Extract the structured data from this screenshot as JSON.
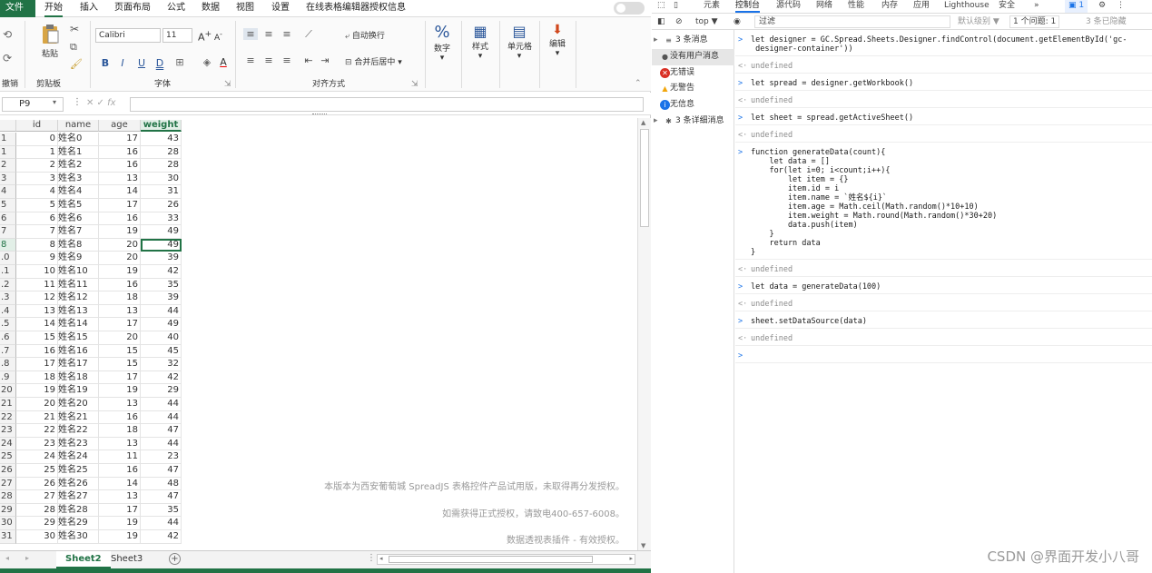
{
  "menu": {
    "tabs": [
      "文件",
      "开始",
      "插入",
      "页面布局",
      "公式",
      "数据",
      "视图",
      "设置",
      "在线表格编辑器授权信息"
    ]
  },
  "ribbon": {
    "undo_label": "撤销",
    "clipboard": {
      "paste": "粘贴",
      "group": "剪贴板"
    },
    "font": {
      "name": "Calibri",
      "size": "11",
      "bold": "B",
      "italic": "I",
      "underline": "U",
      "double_underline": "D",
      "group": "字体"
    },
    "align": {
      "wrap": "自动换行",
      "merge": "合并后居中",
      "group": "对齐方式"
    },
    "number": {
      "label": "数字"
    },
    "style": {
      "label": "样式"
    },
    "cell": {
      "label": "单元格"
    },
    "edit": {
      "label": "编辑"
    }
  },
  "formula": {
    "namebox": "P9",
    "fx": "fx"
  },
  "grid": {
    "columns": [
      "id",
      "name",
      "age",
      "weight"
    ],
    "selected_row": 9,
    "rows": [
      {
        "rh": "1",
        "id": "0",
        "name": "姓名0",
        "age": "17",
        "weight": "43"
      },
      {
        "rh": "1",
        "id": "1",
        "name": "姓名1",
        "age": "16",
        "weight": "28"
      },
      {
        "rh": "2",
        "id": "2",
        "name": "姓名2",
        "age": "16",
        "weight": "28"
      },
      {
        "rh": "3",
        "id": "3",
        "name": "姓名3",
        "age": "13",
        "weight": "30"
      },
      {
        "rh": "4",
        "id": "4",
        "name": "姓名4",
        "age": "14",
        "weight": "31"
      },
      {
        "rh": "5",
        "id": "5",
        "name": "姓名5",
        "age": "17",
        "weight": "26"
      },
      {
        "rh": "6",
        "id": "6",
        "name": "姓名6",
        "age": "16",
        "weight": "33"
      },
      {
        "rh": "7",
        "id": "7",
        "name": "姓名7",
        "age": "19",
        "weight": "49"
      },
      {
        "rh": "8",
        "id": "8",
        "name": "姓名8",
        "age": "20",
        "weight": "49"
      },
      {
        "rh": ".0",
        "id": "9",
        "name": "姓名9",
        "age": "20",
        "weight": "39"
      },
      {
        "rh": ".1",
        "id": "10",
        "name": "姓名10",
        "age": "19",
        "weight": "42"
      },
      {
        "rh": ".2",
        "id": "11",
        "name": "姓名11",
        "age": "16",
        "weight": "35"
      },
      {
        "rh": ".3",
        "id": "12",
        "name": "姓名12",
        "age": "18",
        "weight": "39"
      },
      {
        "rh": ".4",
        "id": "13",
        "name": "姓名13",
        "age": "13",
        "weight": "44"
      },
      {
        "rh": ".5",
        "id": "14",
        "name": "姓名14",
        "age": "17",
        "weight": "49"
      },
      {
        "rh": ".6",
        "id": "15",
        "name": "姓名15",
        "age": "20",
        "weight": "40"
      },
      {
        "rh": ".7",
        "id": "16",
        "name": "姓名16",
        "age": "15",
        "weight": "45"
      },
      {
        "rh": ".8",
        "id": "17",
        "name": "姓名17",
        "age": "15",
        "weight": "32"
      },
      {
        "rh": ".9",
        "id": "18",
        "name": "姓名18",
        "age": "17",
        "weight": "42"
      },
      {
        "rh": "20",
        "id": "19",
        "name": "姓名19",
        "age": "19",
        "weight": "29"
      },
      {
        "rh": "21",
        "id": "20",
        "name": "姓名20",
        "age": "13",
        "weight": "44"
      },
      {
        "rh": "22",
        "id": "21",
        "name": "姓名21",
        "age": "16",
        "weight": "44"
      },
      {
        "rh": "23",
        "id": "22",
        "name": "姓名22",
        "age": "18",
        "weight": "47"
      },
      {
        "rh": "24",
        "id": "23",
        "name": "姓名23",
        "age": "13",
        "weight": "44"
      },
      {
        "rh": "25",
        "id": "24",
        "name": "姓名24",
        "age": "11",
        "weight": "23"
      },
      {
        "rh": "26",
        "id": "25",
        "name": "姓名25",
        "age": "16",
        "weight": "47"
      },
      {
        "rh": "27",
        "id": "26",
        "name": "姓名26",
        "age": "14",
        "weight": "48"
      },
      {
        "rh": "28",
        "id": "27",
        "name": "姓名27",
        "age": "13",
        "weight": "47"
      },
      {
        "rh": "29",
        "id": "28",
        "name": "姓名28",
        "age": "17",
        "weight": "35"
      },
      {
        "rh": "30",
        "id": "29",
        "name": "姓名29",
        "age": "19",
        "weight": "44"
      },
      {
        "rh": "31",
        "id": "30",
        "name": "姓名30",
        "age": "19",
        "weight": "42"
      }
    ]
  },
  "watermark": [
    "本版本为西安葡萄城 SpreadJS 表格控件产品试用版，未取得再分发授权。",
    "如需获得正式授权，请致电400-657-6008。",
    "数据透视表插件 - 有效授权。"
  ],
  "sheets": [
    "Sheet2",
    "Sheet3"
  ],
  "add_sheet": "+",
  "devtools": {
    "tabs": [
      "元素",
      "控制台",
      "源代码",
      "网络",
      "性能",
      "内存",
      "应用",
      "Lighthouse",
      "安全",
      "»"
    ],
    "top": "top ▼",
    "filter": "过滤",
    "level": "默认级别 ▼",
    "issues": "1 个问题: 1",
    "hidden": "3 条已隐藏",
    "badge": "1",
    "sidebar": [
      {
        "label": "3 条消息",
        "icon": "list-icon"
      },
      {
        "label": "没有用户消息",
        "icon": "user-icon"
      },
      {
        "label": "无错误",
        "icon": "error-icon",
        "color": "#d93025"
      },
      {
        "label": "无警告",
        "icon": "warning-icon",
        "color": "#f2a60c"
      },
      {
        "label": "无信息",
        "icon": "info-icon",
        "color": "#1a73e8"
      },
      {
        "label": "3 条详细消息",
        "icon": "bug-icon"
      }
    ],
    "console": [
      {
        "p": ">",
        "t": "let designer = GC.Spread.Sheets.Designer.findControl(document.getElementById('gc-\n designer-container'))",
        "h": 2
      },
      {
        "p": "<·",
        "t": "undefined",
        "u": true,
        "h": 1
      },
      {
        "p": ">",
        "t": "let spread = designer.getWorkbook()",
        "h": 1
      },
      {
        "p": "<·",
        "t": "undefined",
        "u": true,
        "h": 1
      },
      {
        "p": ">",
        "t": "let sheet = spread.getActiveSheet()",
        "h": 1
      },
      {
        "p": "<·",
        "t": "undefined",
        "u": true,
        "h": 1
      },
      {
        "p": ">",
        "t": "function generateData(count){\n    let data = []\n    for(let i=0; i<count;i++){\n        let item = {}\n        item.id = i\n        item.name = `姓名${i}`\n        item.age = Math.ceil(Math.random()*10+10)\n        item.weight = Math.round(Math.random()*30+20)\n        data.push(item)\n    }\n    return data\n}",
        "h": 12
      },
      {
        "p": "<·",
        "t": "undefined",
        "u": true,
        "h": 1
      },
      {
        "p": ">",
        "t": "let data = generateData(100)",
        "h": 1
      },
      {
        "p": "<·",
        "t": "undefined",
        "u": true,
        "h": 1
      },
      {
        "p": ">",
        "t": "sheet.setDataSource(data)",
        "h": 1
      },
      {
        "p": "<·",
        "t": "undefined",
        "u": true,
        "h": 1
      },
      {
        "p": ">",
        "t": "",
        "h": 1
      }
    ]
  },
  "csdn": "CSDN @界面开发小八哥"
}
